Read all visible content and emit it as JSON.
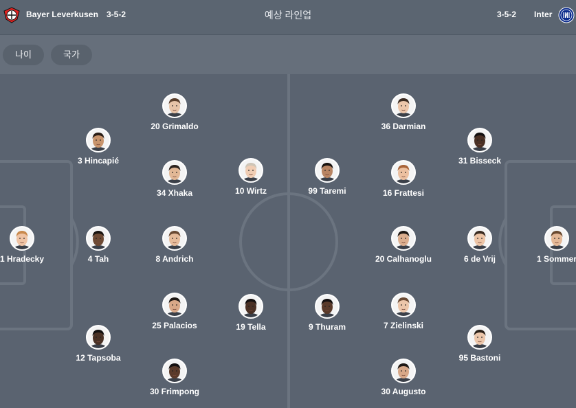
{
  "header": {
    "home_team": "Bayer Leverkusen",
    "home_formation": "3-5-2",
    "title": "예상 라인업",
    "away_formation": "3-5-2",
    "away_team": "Inter",
    "home_logo_icon": "bayer-leverkusen-crest-icon",
    "away_logo_icon": "inter-crest-icon"
  },
  "filters": {
    "age": "나이",
    "country": "국가"
  },
  "colors": {
    "background": "#5a6370",
    "header": "#5b6571",
    "filterbar": "#666f7b",
    "chip": "#59626d",
    "lines": "#6b7480"
  },
  "home_players": [
    {
      "number": "20",
      "name": "Grimaldo",
      "label": "20 Grimaldo",
      "skin": "#e8c4a8",
      "hair": "#5a3e2b"
    },
    {
      "number": "3",
      "name": "Hincapié",
      "label": "3 Hincapié",
      "skin": "#c8946c",
      "hair": "#2a1e16"
    },
    {
      "number": "34",
      "name": "Xhaka",
      "label": "34 Xhaka",
      "skin": "#e2b896",
      "hair": "#2c2420"
    },
    {
      "number": "10",
      "name": "Wirtz",
      "label": "10 Wirtz",
      "skin": "#f0cdb4",
      "hair": "#cfc6b8"
    },
    {
      "number": "1",
      "name": "Hradecky",
      "label": "1 Hradecky",
      "skin": "#efc3a4",
      "hair": "#c98a4e"
    },
    {
      "number": "4",
      "name": "Tah",
      "label": "4 Tah",
      "skin": "#6e4a34",
      "hair": "#1a1410"
    },
    {
      "number": "8",
      "name": "Andrich",
      "label": "8 Andrich",
      "skin": "#e6bb9a",
      "hair": "#6a4a33"
    },
    {
      "number": "25",
      "name": "Palacios",
      "label": "25 Palacios",
      "skin": "#d8a888",
      "hair": "#1e1814"
    },
    {
      "number": "19",
      "name": "Tella",
      "label": "19 Tella",
      "skin": "#4a3024",
      "hair": "#141010"
    },
    {
      "number": "12",
      "name": "Tapsoba",
      "label": "12 Tapsoba",
      "skin": "#4a3226",
      "hair": "#121010"
    },
    {
      "number": "30",
      "name": "Frimpong",
      "label": "30 Frimpong",
      "skin": "#5a3a2a",
      "hair": "#141010"
    }
  ],
  "away_players": [
    {
      "number": "36",
      "name": "Darmian",
      "label": "36 Darmian",
      "skin": "#ecc6aa",
      "hair": "#3a2a20"
    },
    {
      "number": "31",
      "name": "Bisseck",
      "label": "31 Bisseck",
      "skin": "#4a3024",
      "hair": "#141010"
    },
    {
      "number": "99",
      "name": "Taremi",
      "label": "99 Taremi",
      "skin": "#b88462",
      "hair": "#1a1410"
    },
    {
      "number": "16",
      "name": "Frattesi",
      "label": "16 Frattesi",
      "skin": "#ecc0a0",
      "hair": "#a8643a"
    },
    {
      "number": "20",
      "name": "Calhanoglu",
      "label": "20 Calhanoglu",
      "skin": "#dcae8e",
      "hair": "#1e1814"
    },
    {
      "number": "6",
      "name": "de Vrij",
      "label": "6 de Vrij",
      "skin": "#ecc4a6",
      "hair": "#3a2c22"
    },
    {
      "number": "1",
      "name": "Sommer",
      "label": "1 Sommer",
      "skin": "#e4b896",
      "hair": "#6a4a30"
    },
    {
      "number": "9",
      "name": "Thuram",
      "label": "9 Thuram",
      "skin": "#5a3a2a",
      "hair": "#141010"
    },
    {
      "number": "7",
      "name": "Zielinski",
      "label": "7 Zielinski",
      "skin": "#ecc6aa",
      "hair": "#6a4a33"
    },
    {
      "number": "95",
      "name": "Bastoni",
      "label": "95 Bastoni",
      "skin": "#ecc6aa",
      "hair": "#2a2018"
    },
    {
      "number": "30",
      "name": "Augusto",
      "label": "30 Augusto",
      "skin": "#d8a888",
      "hair": "#1e1814"
    }
  ]
}
